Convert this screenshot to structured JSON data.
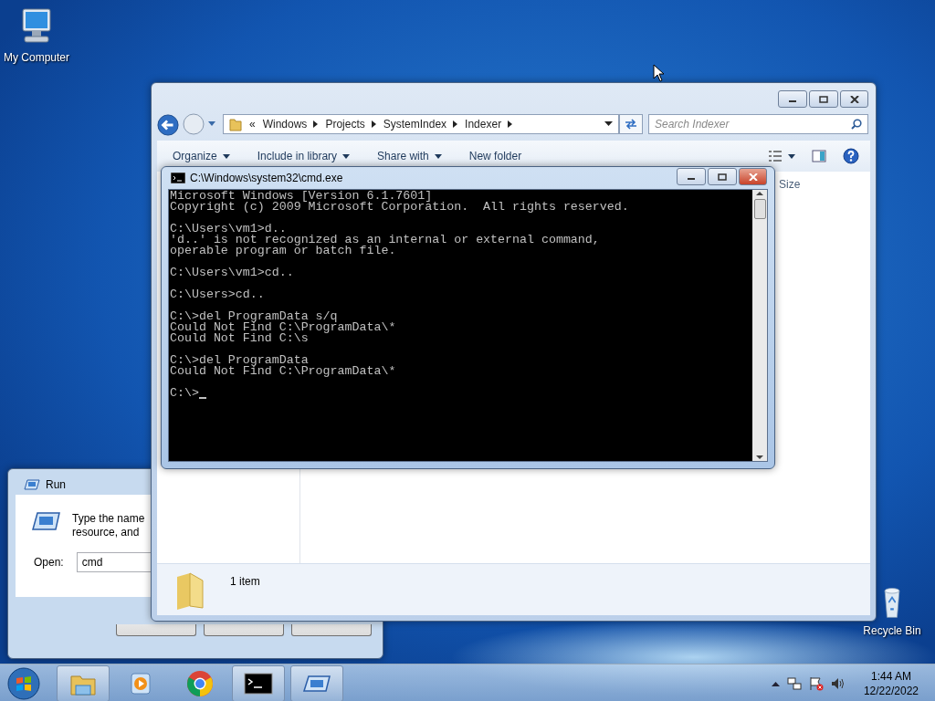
{
  "desktop_icons": [
    {
      "kind": "computer",
      "label": "My Computer"
    },
    {
      "kind": "recycle",
      "label": "Recycle Bin"
    }
  ],
  "run_dialog": {
    "title": "Run",
    "description": [
      "Type the name",
      "resource, and"
    ],
    "open_label": "Open:",
    "open_value": "cmd"
  },
  "explorer": {
    "overflow": "«",
    "breadcrumb": [
      "Windows",
      "Projects",
      "SystemIndex",
      "Indexer"
    ],
    "search_placeholder": "Search Indexer",
    "toolbar": [
      {
        "label": "Organize",
        "dropdown": true
      },
      {
        "label": "Include in library",
        "dropdown": true
      },
      {
        "label": "Share with",
        "dropdown": true
      },
      {
        "label": "New folder",
        "dropdown": false
      }
    ],
    "column_header": "Size",
    "status": "1 item"
  },
  "cmd": {
    "title": "C:\\Windows\\system32\\cmd.exe",
    "blocks": [
      [
        "Microsoft Windows [Version 6.1.7601]",
        "Copyright (c) 2009 Microsoft Corporation.  All rights reserved."
      ],
      [
        "C:\\Users\\vm1>d..",
        "'d..' is not recognized as an internal or external command,",
        "operable program or batch file."
      ],
      [
        "C:\\Users\\vm1>cd.."
      ],
      [
        "C:\\Users>cd.."
      ],
      [
        "C:\\>del ProgramData s/q",
        "Could Not Find C:\\ProgramData\\*",
        "Could Not Find C:\\s"
      ],
      [
        "C:\\>del ProgramData",
        "Could Not Find C:\\ProgramData\\*"
      ],
      [
        "C:\\>"
      ]
    ]
  },
  "taskbar": {
    "buttons": [
      {
        "kind": "explorer",
        "running": true
      },
      {
        "kind": "media",
        "running": false
      },
      {
        "kind": "chrome",
        "running": false
      },
      {
        "kind": "cmd",
        "running": true
      },
      {
        "kind": "run",
        "running": true
      }
    ],
    "time": "1:44 AM",
    "date": "12/22/2022"
  }
}
